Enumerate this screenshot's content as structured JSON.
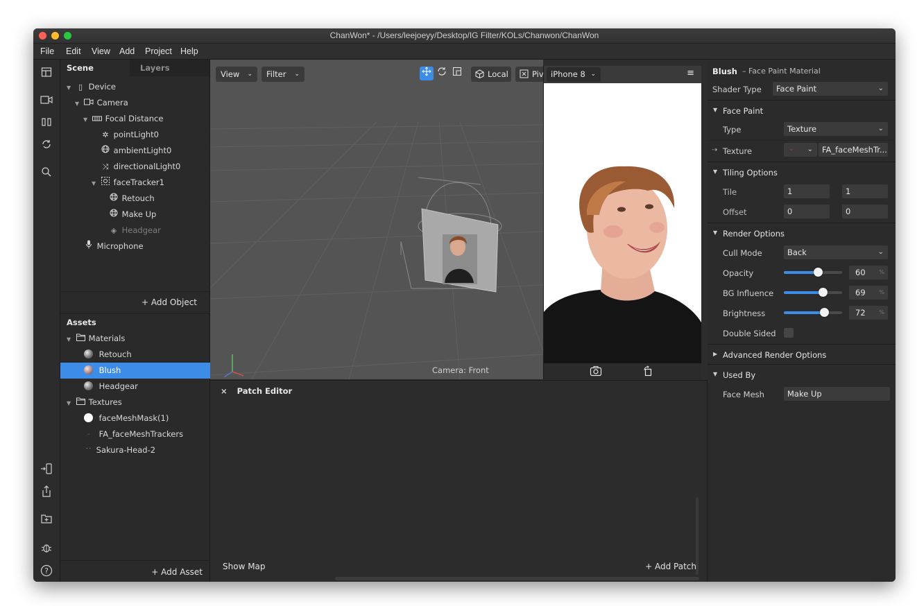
{
  "window": {
    "title": "ChanWon* - /Users/leejoeyy/Desktop/IG Filter/KOLs/Chanwon/ChanWon"
  },
  "menu": [
    "File",
    "Edit",
    "View",
    "Add",
    "Project",
    "Help"
  ],
  "scene": {
    "tabs": [
      "Scene",
      "Layers"
    ],
    "tree": [
      {
        "label": "Device",
        "icon": "phone-icon"
      },
      {
        "label": "Camera",
        "icon": "camera-icon"
      },
      {
        "label": "Focal Distance",
        "icon": "focal-icon"
      },
      {
        "label": "pointLight0",
        "icon": "point-light-icon"
      },
      {
        "label": "ambientLight0",
        "icon": "ambient-light-icon"
      },
      {
        "label": "directionalLight0",
        "icon": "directional-light-icon"
      },
      {
        "label": "faceTracker1",
        "icon": "face-tracker-icon"
      },
      {
        "label": "Retouch",
        "icon": "face-mesh-icon"
      },
      {
        "label": "Make Up",
        "icon": "face-mesh-icon"
      },
      {
        "label": "Headgear",
        "icon": "occluder-icon"
      },
      {
        "label": "Microphone",
        "icon": "microphone-icon"
      }
    ],
    "add_object": "+ Add Object"
  },
  "assets": {
    "title": "Assets",
    "rows": [
      {
        "label": "Materials",
        "kind": "folder"
      },
      {
        "label": "Retouch",
        "kind": "material"
      },
      {
        "label": "Blush",
        "kind": "material",
        "selected": true
      },
      {
        "label": "Headgear",
        "kind": "material"
      },
      {
        "label": "Textures",
        "kind": "folder"
      },
      {
        "label": "faceMeshMask(1)",
        "kind": "texture"
      },
      {
        "label": "FA_faceMeshTrackers",
        "kind": "texture"
      },
      {
        "label": "Sakura-Head-2",
        "kind": "texture"
      }
    ],
    "add_asset": "+ Add Asset"
  },
  "viewport": {
    "view_button": "View",
    "filter_button": "Filter",
    "local_button": "Local",
    "pivot_button": "Pivot",
    "camera_label": "Camera: Front"
  },
  "simulator": {
    "device": "iPhone 8"
  },
  "patch_editor": {
    "title": "Patch Editor",
    "show_map": "Show Map",
    "add_patch": "+ Add Patch"
  },
  "inspector": {
    "name": "Blush",
    "subtitle": "– Face Paint Material",
    "shader_type_label": "Shader Type",
    "shader_type_value": "Face Paint",
    "face_paint_section": "Face Paint",
    "type_label": "Type",
    "type_value": "Texture",
    "texture_label": "Texture",
    "texture_value": "FA_faceMeshTr...",
    "tiling_section": "Tiling Options",
    "tile_label": "Tile",
    "tile_x": "1",
    "tile_y": "1",
    "offset_label": "Offset",
    "offset_x": "0",
    "offset_y": "0",
    "render_section": "Render Options",
    "cull_label": "Cull Mode",
    "cull_value": "Back",
    "opacity_label": "Opacity",
    "opacity_value": "60",
    "bg_label": "BG Influence",
    "bg_value": "69",
    "brightness_label": "Brightness",
    "brightness_value": "72",
    "pct": "%",
    "double_sided_label": "Double Sided",
    "advanced_section": "Advanced Render Options",
    "used_by_section": "Used By",
    "face_mesh_label": "Face Mesh",
    "face_mesh_value": "Make Up"
  },
  "colors": {
    "accent": "#3d8ce8",
    "panel": "#2b2b2b",
    "viewport": "#545454"
  }
}
